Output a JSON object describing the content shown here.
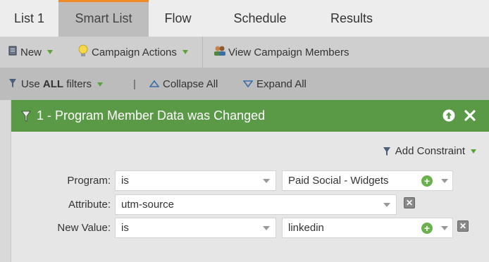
{
  "tabs": [
    {
      "label": "List 1"
    },
    {
      "label": "Smart List"
    },
    {
      "label": "Flow"
    },
    {
      "label": "Schedule"
    },
    {
      "label": "Results"
    }
  ],
  "toolbar": {
    "new_label": "New",
    "campaign_actions_label": "Campaign Actions",
    "view_members_label": "View Campaign Members"
  },
  "filter_bar": {
    "use_prefix": "Use",
    "use_value": "ALL",
    "use_suffix": "filters",
    "separator": "|",
    "collapse_label": "Collapse All",
    "expand_label": "Expand All"
  },
  "filter": {
    "title": "1 - Program Member Data was Changed",
    "add_constraint_label": "Add Constraint",
    "rows": [
      {
        "label": "Program:",
        "operator": "is",
        "value": "Paid Social - Widgets"
      },
      {
        "label": "Attribute:",
        "value": "utm-source"
      },
      {
        "label": "New Value:",
        "operator": "is",
        "value": "linkedin"
      }
    ]
  },
  "colors": {
    "accent_tab": "#f08a24",
    "filter_header": "#5a9a47",
    "add_green": "#6ab04c"
  }
}
